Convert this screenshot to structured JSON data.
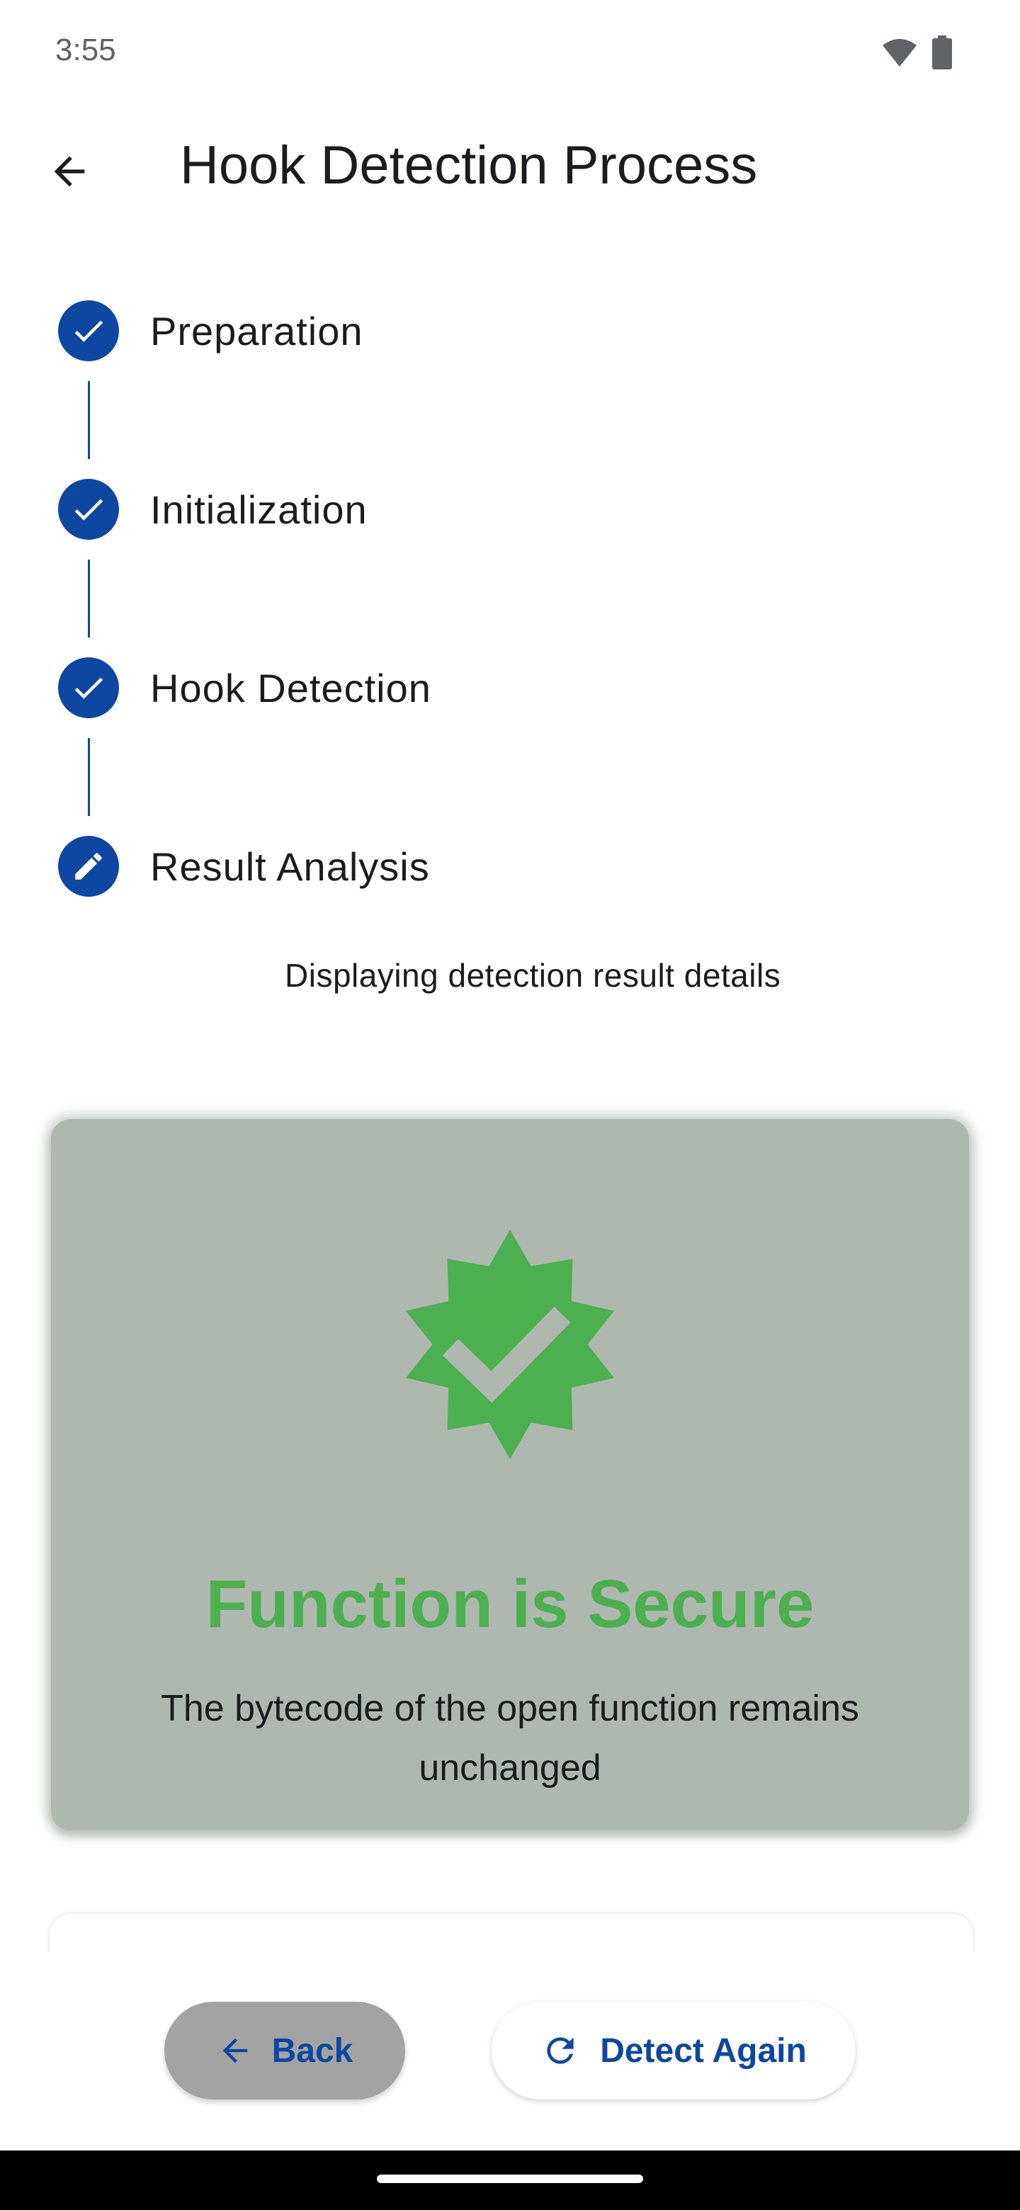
{
  "status_bar": {
    "time": "3:55",
    "icons": [
      "wifi-icon",
      "battery-icon"
    ]
  },
  "app_bar": {
    "back_icon": "arrow-left-icon",
    "title": "Hook Detection Process"
  },
  "stepper": {
    "steps": [
      {
        "label": "Preparation",
        "state": "completed",
        "icon": "check-icon"
      },
      {
        "label": "Initialization",
        "state": "completed",
        "icon": "check-icon"
      },
      {
        "label": "Hook Detection",
        "state": "completed",
        "icon": "check-icon"
      },
      {
        "label": "Result Analysis",
        "state": "editing",
        "icon": "pencil-icon"
      }
    ],
    "active_step_description": "Displaying detection result details"
  },
  "result_card": {
    "icon": "verified-badge-icon",
    "title": "Function is Secure",
    "description": "The bytecode of the open function remains unchanged"
  },
  "actions": {
    "back_label": "Back",
    "back_icon": "arrow-left-icon",
    "detect_again_label": "Detect Again",
    "detect_again_icon": "refresh-icon"
  },
  "colors": {
    "primary": "#0d47a1",
    "success": "#4caf50",
    "card_background": "#afb8af",
    "back_button_background": "#a3a3a3"
  }
}
